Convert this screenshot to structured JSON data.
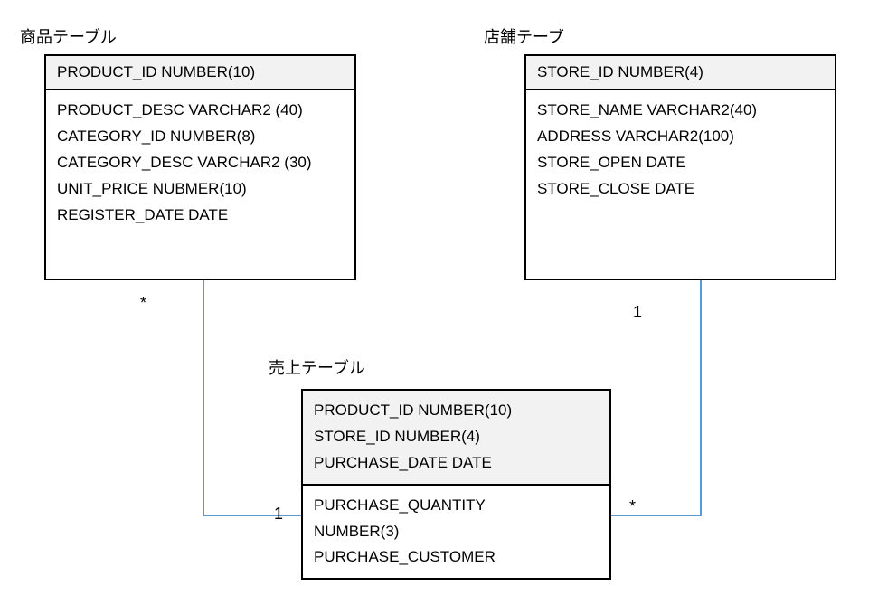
{
  "tables": {
    "product": {
      "title": "商品テーブル",
      "key": "PRODUCT_ID  NUMBER(10)",
      "col1": "PRODUCT_DESC  VARCHAR2 (40)",
      "col2": "CATEGORY_ID  NUMBER(8)",
      "col3": "CATEGORY_DESC  VARCHAR2 (30)",
      "col4": "UNIT_PRICE  NUBMER(10)",
      "col5": "REGISTER_DATE  DATE"
    },
    "store": {
      "title": "店舗テーブ",
      "key": "STORE_ID  NUMBER(4)",
      "col1": "STORE_NAME  VARCHAR2(40)",
      "col2": "ADDRESS  VARCHAR2(100)",
      "col3": "STORE_OPEN  DATE",
      "col4": "STORE_CLOSE  DATE"
    },
    "sales": {
      "title": "売上テーブル",
      "key1": "PRODUCT_ID  NUMBER(10)",
      "key2": "STORE_ID  NUMBER(4)",
      "key3": "PURCHASE_DATE  DATE",
      "col1": "PURCHASE_QUANTITY",
      "col2": "NUMBER(3)",
      "col3": "PURCHASE_CUSTOMER"
    }
  },
  "cardinality": {
    "productSide": "*",
    "storeSide": "1",
    "salesLeft": "1",
    "salesRight": "*"
  }
}
